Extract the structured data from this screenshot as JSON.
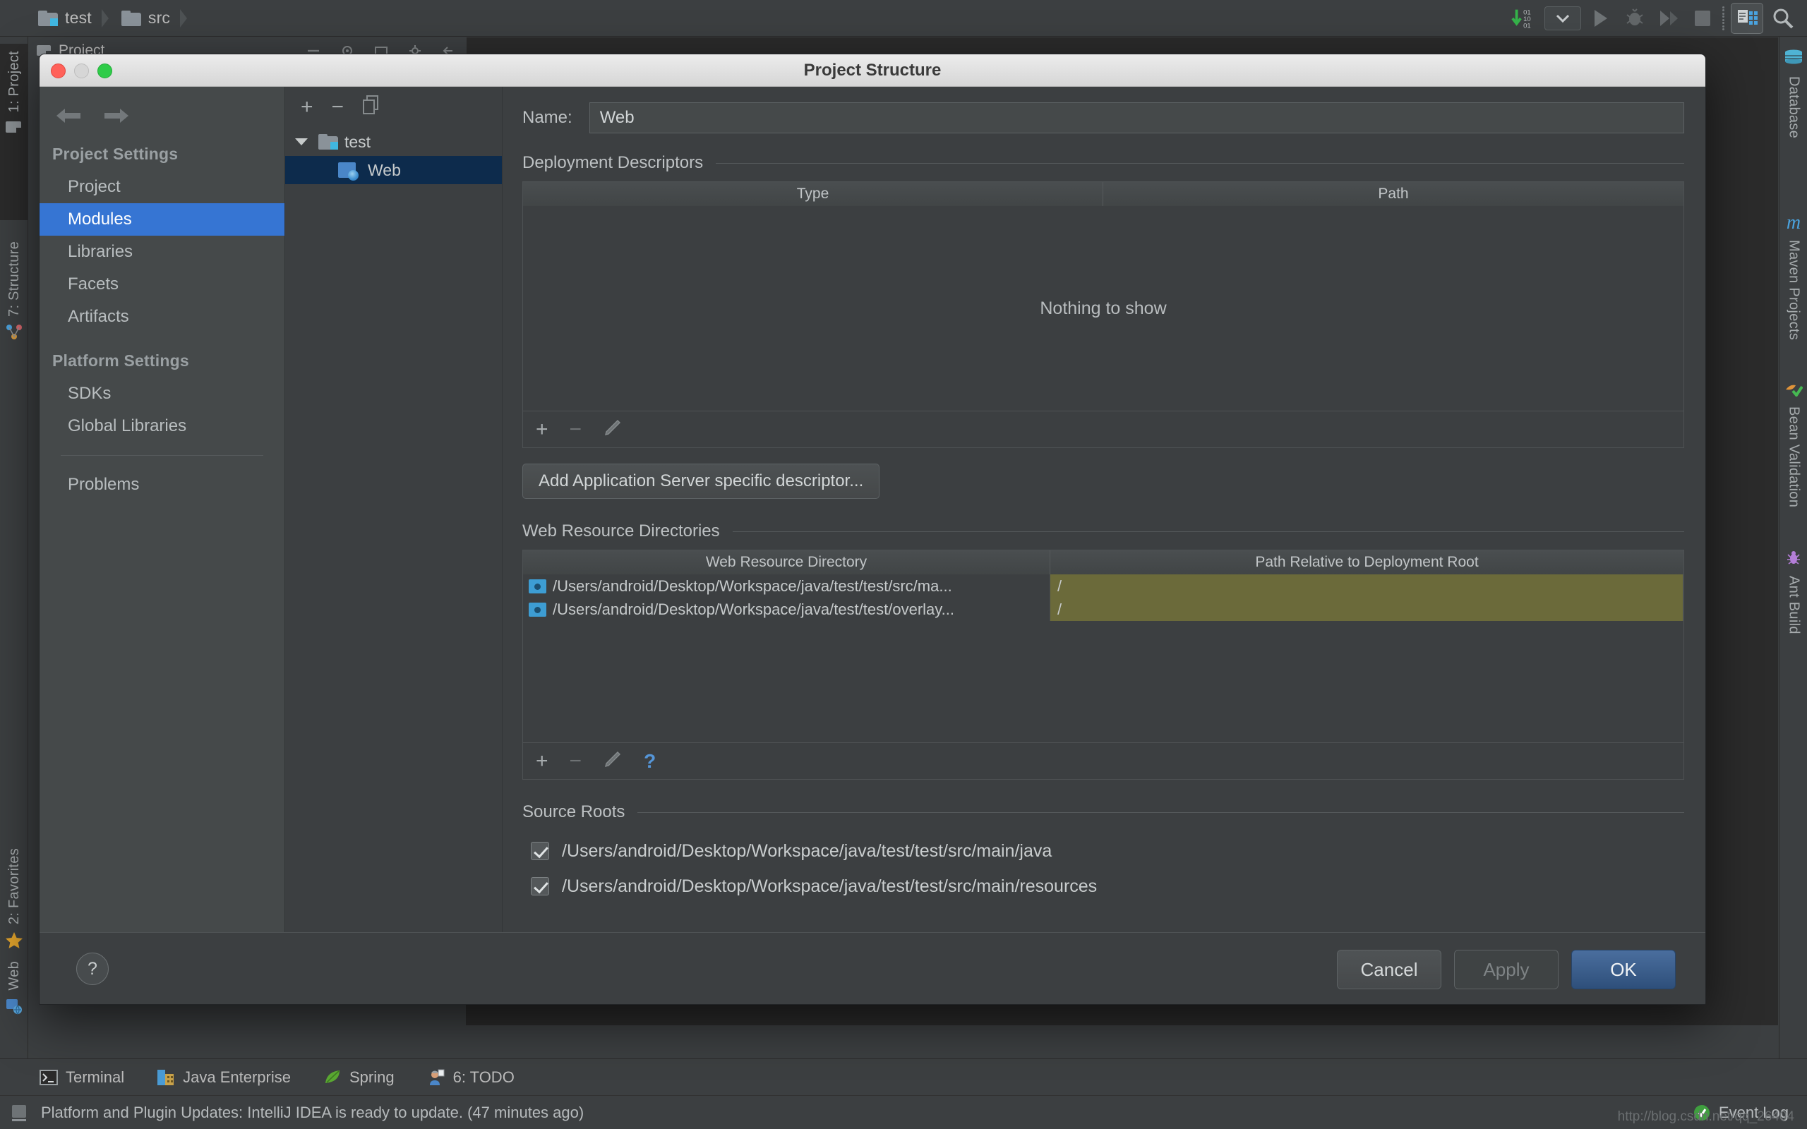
{
  "breadcrumb": {
    "items": [
      {
        "label": "test",
        "icon": "folder-module-icon"
      },
      {
        "label": "src",
        "icon": "folder-icon"
      }
    ]
  },
  "toolbar_right": {
    "items": [
      {
        "name": "update-indicator-icon",
        "glyph": "01 10 01"
      },
      {
        "name": "run-configuration-dropdown",
        "glyph": "▼"
      },
      {
        "name": "run-button",
        "glyph": "▶"
      },
      {
        "name": "debug-button",
        "glyph": "🐞"
      },
      {
        "name": "run-coverage-button",
        "glyph": "▶"
      },
      {
        "name": "stop-button",
        "glyph": "■"
      },
      {
        "name": "project-structure-button",
        "glyph": "⬚"
      },
      {
        "name": "search-everywhere-icon",
        "glyph": "🔍"
      }
    ]
  },
  "left_tool_tabs": [
    {
      "label": "1: Project",
      "icon": "project-icon",
      "selected": true
    },
    {
      "label": "7: Structure",
      "icon": "structure-icon",
      "selected": false
    },
    {
      "label": "2: Favorites",
      "icon": "star-icon",
      "selected": false
    },
    {
      "label": "Web",
      "icon": "web-icon",
      "selected": false
    }
  ],
  "right_tool_tabs": [
    {
      "label": "Database",
      "icon": "database-icon"
    },
    {
      "label": "Maven Projects",
      "icon": "maven-icon"
    },
    {
      "label": "Bean Validation",
      "icon": "bean-validation-icon"
    },
    {
      "label": "Ant Build",
      "icon": "ant-icon"
    }
  ],
  "project_panel": {
    "title": "Project"
  },
  "tool_windows": [
    {
      "label": "Terminal",
      "icon": "terminal-icon"
    },
    {
      "label": "Java Enterprise",
      "icon": "java-enterprise-icon"
    },
    {
      "label": "Spring",
      "icon": "spring-icon"
    },
    {
      "label": "6: TODO",
      "icon": "todo-icon"
    }
  ],
  "status_bar": {
    "message": "Platform and Plugin Updates: IntelliJ IDEA is ready to update. (47 minutes ago)",
    "event_log": "Event Log",
    "watermark": "http://blog.csdn.net/qq_26404"
  },
  "dialog": {
    "title": "Project Structure",
    "sidebar": {
      "back_label": "Back",
      "forward_label": "Forward",
      "groups": [
        {
          "title": "Project Settings",
          "items": [
            {
              "label": "Project",
              "selected": false
            },
            {
              "label": "Modules",
              "selected": true
            },
            {
              "label": "Libraries",
              "selected": false
            },
            {
              "label": "Facets",
              "selected": false
            },
            {
              "label": "Artifacts",
              "selected": false
            }
          ]
        },
        {
          "title": "Platform Settings",
          "items": [
            {
              "label": "SDKs",
              "selected": false
            },
            {
              "label": "Global Libraries",
              "selected": false
            }
          ]
        }
      ],
      "extra": [
        {
          "label": "Problems",
          "selected": false
        }
      ]
    },
    "module_tree": {
      "toolbar": [
        {
          "name": "add-module-button",
          "glyph": "+"
        },
        {
          "name": "remove-module-button",
          "glyph": "−"
        },
        {
          "name": "copy-module-button",
          "glyph": "❐"
        }
      ],
      "nodes": [
        {
          "label": "test",
          "type": "project",
          "expanded": true,
          "selected": false
        },
        {
          "label": "Web",
          "type": "facet",
          "expanded": false,
          "selected": true
        }
      ]
    },
    "content": {
      "name_label": "Name:",
      "name_value": "Web",
      "deployment_descriptors": {
        "title": "Deployment Descriptors",
        "columns": [
          "Type",
          "Path"
        ],
        "rows": [],
        "empty_text": "Nothing to show",
        "toolbar": [
          {
            "name": "add-descriptor-button",
            "glyph": "+",
            "enabled": true
          },
          {
            "name": "remove-descriptor-button",
            "glyph": "−",
            "enabled": false
          },
          {
            "name": "edit-descriptor-button",
            "glyph": "✎",
            "enabled": false
          }
        ],
        "add_button_label": "Add Application Server specific descriptor..."
      },
      "web_resource_directories": {
        "title": "Web Resource Directories",
        "columns": [
          "Web Resource Directory",
          "Path Relative to Deployment Root"
        ],
        "rows": [
          {
            "directory": "/Users/android/Desktop/Workspace/java/test/test/src/ma...",
            "relative_path": "/"
          },
          {
            "directory": "/Users/android/Desktop/Workspace/java/test/test/overlay...",
            "relative_path": "/"
          }
        ],
        "toolbar": [
          {
            "name": "add-web-resource-button",
            "glyph": "+",
            "enabled": true
          },
          {
            "name": "remove-web-resource-button",
            "glyph": "−",
            "enabled": false
          },
          {
            "name": "edit-web-resource-button",
            "glyph": "✎",
            "enabled": false
          },
          {
            "name": "help-web-resource-button",
            "glyph": "?",
            "enabled": true
          }
        ]
      },
      "source_roots": {
        "title": "Source Roots",
        "items": [
          {
            "path": "/Users/android/Desktop/Workspace/java/test/test/src/main/java",
            "checked": true
          },
          {
            "path": "/Users/android/Desktop/Workspace/java/test/test/src/main/resources",
            "checked": true
          }
        ]
      }
    },
    "footer": {
      "help_label": "?",
      "cancel_label": "Cancel",
      "apply_label": "Apply",
      "ok_label": "OK"
    }
  },
  "colors": {
    "accent_blue": "#3675d3",
    "selection_tree": "#0d2b4c",
    "highlight_yellow": "#6b6a3a",
    "primary_button": "#2e4f7a",
    "panel_bg": "#3c3f41",
    "sidebar_bg": "#45494a"
  }
}
